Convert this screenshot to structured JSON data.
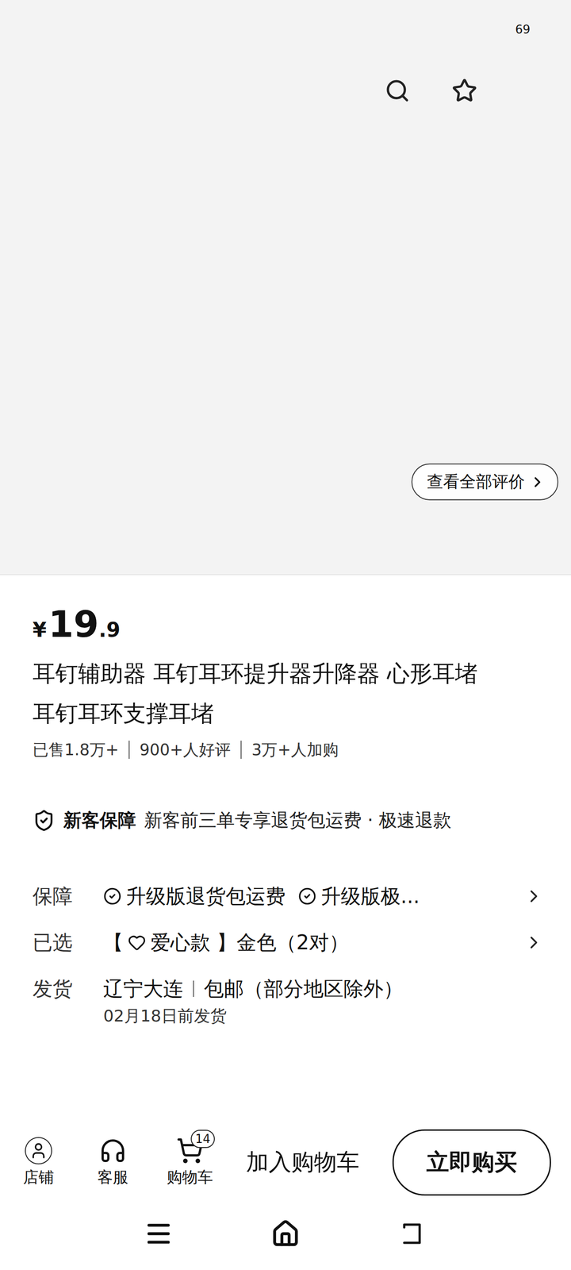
{
  "status_bar": {
    "battery": "69"
  },
  "gallery": {
    "review_link": "查看全部评价"
  },
  "price": {
    "currency": "¥",
    "integer": "19",
    "decimal": ".9"
  },
  "title_lines": [
    "耳钉辅助器 耳钉耳环提升器升降器 心形耳堵",
    "耳钉耳环支撑耳堵"
  ],
  "stats": [
    "已售1.8万+",
    "900+人好评",
    "3万+人加购"
  ],
  "new_customer": {
    "label": "新客保障",
    "text": "新客前三单专享退货包运费 · 极速退款"
  },
  "rows": [
    {
      "label": "保障",
      "kind": "guarantee",
      "items": [
        "升级版退货包运费",
        "升级版极..."
      ],
      "arrow": true
    },
    {
      "label": "已选",
      "kind": "selection",
      "before": "【",
      "after": "爱心款 】金色（2对）",
      "arrow": true
    },
    {
      "label": "发货",
      "kind": "shipping",
      "origin": "辽宁大连",
      "shipping": "包邮（部分地区除外）",
      "note": "02月18日前发货",
      "arrow": false
    }
  ],
  "bottom_bar": {
    "icons": [
      {
        "label": "店铺",
        "badge": ""
      },
      {
        "label": "客服",
        "badge": ""
      },
      {
        "label": "购物车",
        "badge": "14"
      }
    ],
    "add_to_cart": "加入购物车",
    "buy_now": "立即购买"
  }
}
